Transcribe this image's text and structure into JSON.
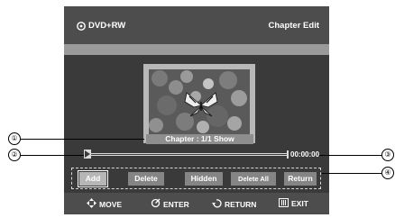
{
  "header": {
    "disc_label": "DVD+RW",
    "title": "Chapter Edit"
  },
  "preview": {
    "caption": "Chapter : 1/1 Show"
  },
  "timeline": {
    "time": "00:00:00",
    "progress_fraction": 0.0
  },
  "buttons": [
    {
      "label": "Add",
      "selected": true
    },
    {
      "label": "Delete",
      "selected": false
    },
    {
      "label": "Hidden",
      "selected": false
    },
    {
      "label": "Delete All",
      "selected": false
    },
    {
      "label": "Return",
      "selected": false
    }
  ],
  "footer": {
    "move": "MOVE",
    "enter": "ENTER",
    "return": "RETURN",
    "exit": "EXIT"
  },
  "callouts": {
    "c1": "①",
    "c2": "②",
    "c3": "③",
    "c4": "④"
  },
  "colors": {
    "screen_bg": "#3a3a3a",
    "bar_bg": "#4d4d4d",
    "button_bg": "#858585",
    "button_selected_bg": "#b6b6b6"
  }
}
